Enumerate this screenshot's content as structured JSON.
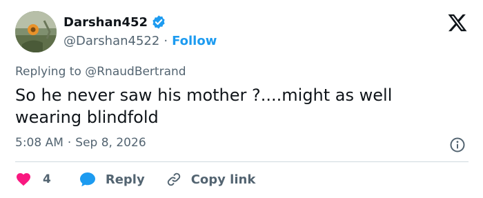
{
  "user": {
    "display_name": "Darshan452",
    "handle": "@Darshan4522",
    "separator": "·",
    "follow_label": "Follow"
  },
  "tweet": {
    "reply_to": "Replying to @RnaudBertrand",
    "text": "So he never saw his mother ?....might as well wearing blindfold",
    "time": "5:08 AM",
    "date": "Sep 8, 2026",
    "meta_separator": "·"
  },
  "actions": {
    "like_count": "4",
    "reply_label": "Reply",
    "copy_label": "Copy link"
  },
  "colors": {
    "accent": "#1d9bf0",
    "like": "#f91880",
    "muted": "#536471",
    "text": "#0f1419"
  },
  "icons": {
    "verified": "verified-badge-icon",
    "logo": "x-logo-icon",
    "info": "info-icon",
    "like": "heart-icon",
    "reply": "speech-bubble-icon",
    "copy": "link-icon"
  }
}
